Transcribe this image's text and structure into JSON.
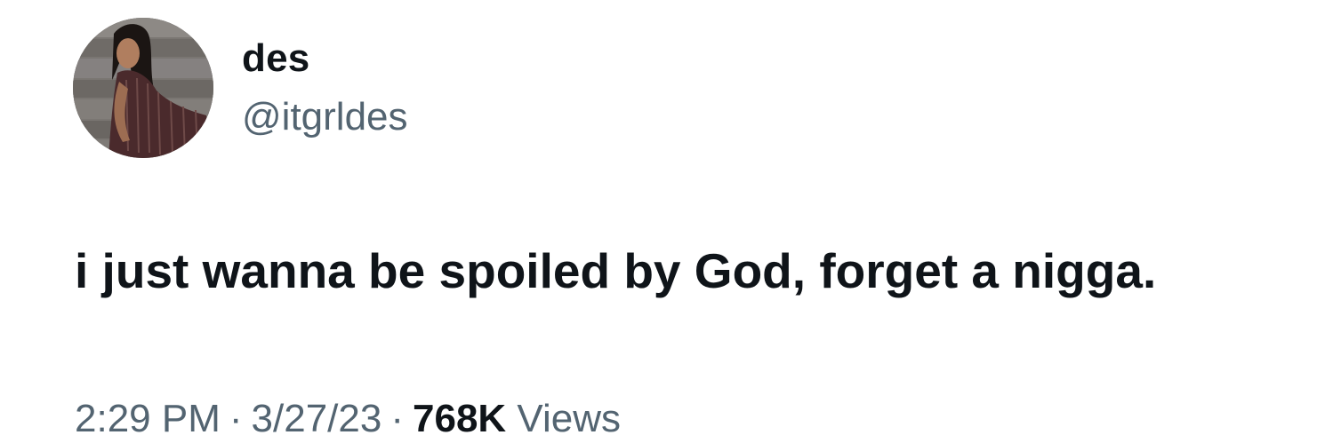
{
  "author": {
    "display_name": "des",
    "handle": "@itgrldes",
    "avatar_icon": "profile-photo"
  },
  "tweet": {
    "text": "i just wanna be spoiled by God, forget a nigga."
  },
  "meta": {
    "time": "2:29 PM",
    "separator": "·",
    "date": "3/27/23",
    "views_count": "768K",
    "views_label": "Views"
  },
  "colors": {
    "text_primary": "#0f1419",
    "text_secondary": "#536471",
    "background": "#ffffff"
  }
}
